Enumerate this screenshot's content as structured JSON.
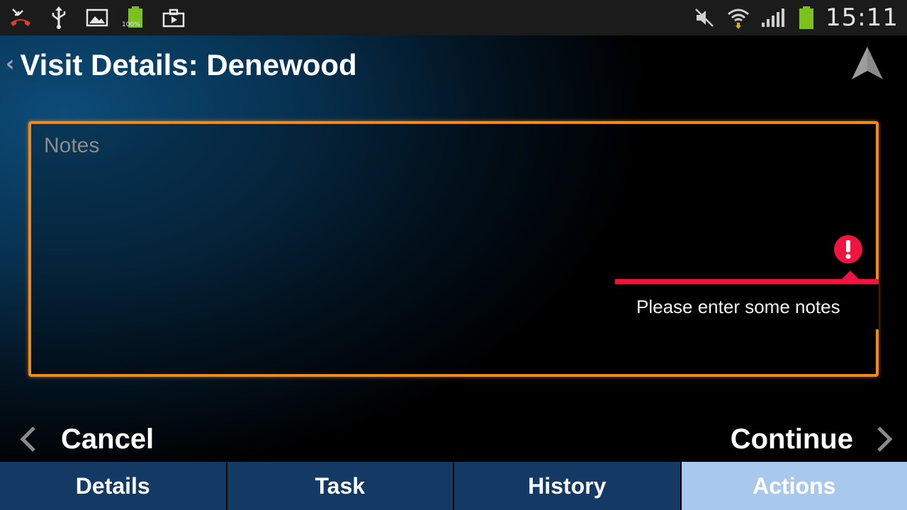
{
  "status_bar": {
    "left_icons": [
      "missed-call-icon",
      "usb-icon",
      "gallery-icon",
      "battery-full-icon",
      "briefcase-icon"
    ],
    "battery_badge": "100%",
    "right_icons": [
      "mute-icon",
      "wifi-icon",
      "signal-icon",
      "battery-icon"
    ],
    "time": "15:11",
    "colors": {
      "missed_call": "#d8402e",
      "battery": "#7cc21e"
    }
  },
  "header": {
    "title": "Visit Details: Denewood",
    "back_glyph": "‹",
    "nav_icon": "navigation-arrow-icon"
  },
  "notes": {
    "placeholder": "Notes",
    "value": "",
    "border_color": "#f08a1c"
  },
  "error": {
    "message": "Please enter some notes",
    "color": "#f01442",
    "icon": "error-icon"
  },
  "actions": {
    "cancel_label": "Cancel",
    "continue_label": "Continue"
  },
  "tabs": [
    {
      "label": "Details",
      "active": false
    },
    {
      "label": "Task",
      "active": false
    },
    {
      "label": "History",
      "active": false
    },
    {
      "label": "Actions",
      "active": true
    }
  ]
}
